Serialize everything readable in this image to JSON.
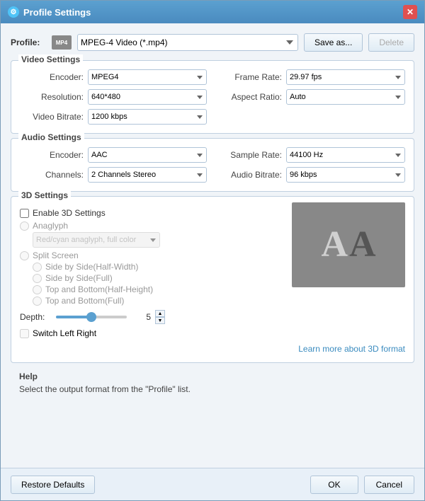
{
  "window": {
    "title": "Profile Settings",
    "icon": "settings-icon"
  },
  "profile": {
    "label": "Profile:",
    "value": "MPEG-4 Video (*.mp4)",
    "save_as": "Save as...",
    "delete": "Delete"
  },
  "video_settings": {
    "section_title": "Video Settings",
    "encoder_label": "Encoder:",
    "encoder_value": "MPEG4",
    "resolution_label": "Resolution:",
    "resolution_value": "640*480",
    "video_bitrate_label": "Video Bitrate:",
    "video_bitrate_value": "1200 kbps",
    "frame_rate_label": "Frame Rate:",
    "frame_rate_value": "29.97 fps",
    "aspect_ratio_label": "Aspect Ratio:",
    "aspect_ratio_value": "Auto"
  },
  "audio_settings": {
    "section_title": "Audio Settings",
    "encoder_label": "Encoder:",
    "encoder_value": "AAC",
    "channels_label": "Channels:",
    "channels_value": "2 Channels Stereo",
    "sample_rate_label": "Sample Rate:",
    "sample_rate_value": "44100 Hz",
    "audio_bitrate_label": "Audio Bitrate:",
    "audio_bitrate_value": "96 kbps"
  },
  "settings_3d": {
    "section_title": "3D Settings",
    "enable_label": "Enable 3D Settings",
    "anaglyph_label": "Anaglyph",
    "anaglyph_option": "Red/cyan anaglyph, full color",
    "split_screen_label": "Split Screen",
    "side_by_side_half": "Side by Side(Half-Width)",
    "side_by_side_full": "Side by Side(Full)",
    "top_bottom_half": "Top and Bottom(Half-Height)",
    "top_bottom_full": "Top and Bottom(Full)",
    "depth_label": "Depth:",
    "depth_value": "5",
    "switch_label": "Switch Left Right",
    "learn_more": "Learn more about 3D format"
  },
  "help": {
    "section_title": "Help",
    "text": "Select the output format from the \"Profile\" list."
  },
  "footer": {
    "restore_defaults": "Restore Defaults",
    "ok": "OK",
    "cancel": "Cancel"
  }
}
